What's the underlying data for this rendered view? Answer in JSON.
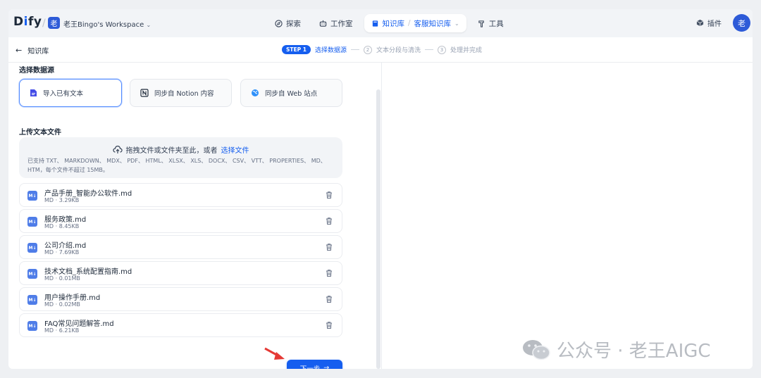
{
  "topbar": {
    "logo_text": "Dify",
    "workspace_avatar": "老",
    "workspace_name": "老王Bingo's Workspace",
    "nav": {
      "explore": "探索",
      "studio": "工作室",
      "knowledge": "知识库",
      "knowledge_sub": "客服知识库",
      "tools": "工具"
    },
    "plugins": "插件",
    "user_avatar": "老"
  },
  "header": {
    "back_label": "知识库",
    "step1_badge": "STEP 1",
    "step1_label": "选择数据源",
    "step2_num": "2",
    "step2_label": "文本分段与清洗",
    "step3_num": "3",
    "step3_label": "处理并完成"
  },
  "datasource": {
    "title": "选择数据源",
    "options": [
      {
        "label": "导入已有文本",
        "icon": "file-text-icon"
      },
      {
        "label": "同步自 Notion 内容",
        "icon": "notion-icon"
      },
      {
        "label": "同步自 Web 站点",
        "icon": "web-icon"
      }
    ]
  },
  "upload": {
    "title": "上传文本文件",
    "drag_text": "拖拽文件或文件夹至此，或者",
    "select_link": "选择文件",
    "hint": "已支持 TXT、 MARKDOWN、 MDX、 PDF、 HTML、 XLSX、 XLS、 DOCX、 CSV、 VTT、 PROPERTIES、 MD、 HTM，每个文件不超过 15MB。"
  },
  "files": [
    {
      "name": "产品手册_智能办公软件.md",
      "meta": "MD · 3.29KB"
    },
    {
      "name": "服务政策.md",
      "meta": "MD · 8.45KB"
    },
    {
      "name": "公司介绍.md",
      "meta": "MD · 7.69KB"
    },
    {
      "name": "技术文档_系统配置指南.md",
      "meta": "MD · 0.01MB"
    },
    {
      "name": "用户操作手册.md",
      "meta": "MD · 0.02MB"
    },
    {
      "name": "FAQ常见问题解答.md",
      "meta": "MD · 6.21KB"
    }
  ],
  "file_icon_text": "M↓",
  "next_button": "下一步",
  "watermark": "公众号 · 老王AIGC",
  "colors": {
    "accent": "#155eef",
    "file_icon": "#4f7de8",
    "arrow": "#e53935"
  }
}
